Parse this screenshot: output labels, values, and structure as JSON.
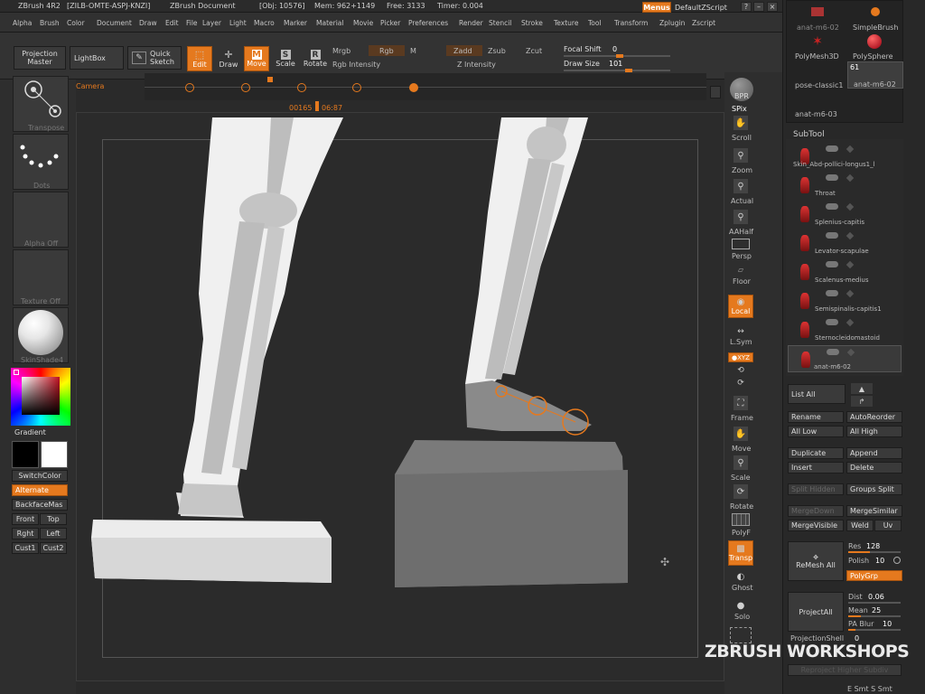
{
  "titlebar": {
    "app": "ZBrush 4R2",
    "key": "[ZILB-OMTE-ASPJ-KNZI]",
    "doc": "ZBrush Document",
    "obj": "[Obj: 10576]",
    "mem": "Mem: 962+1149",
    "free": "Free: 3133",
    "timer": "Timer: 0.004",
    "menus_btn": "Menus",
    "script_label": "DefaultZScript"
  },
  "menubar": {
    "items": [
      "Alpha",
      "Brush",
      "Color",
      "Document",
      "Draw",
      "Edit",
      "File",
      "Layer",
      "Light",
      "Macro",
      "Marker",
      "Material",
      "Movie",
      "Picker",
      "Preferences",
      "Render",
      "Stencil",
      "Stroke",
      "Texture",
      "Tool",
      "Transform",
      "Zplugin",
      "Zscript"
    ]
  },
  "toolbar": {
    "projection_master": "Projection Master",
    "lightbox": "LightBox",
    "quick_sketch": "Quick Sketch",
    "edit": "Edit",
    "draw": "Draw",
    "move": "Move",
    "scale": "Scale",
    "rotate": "Rotate",
    "mrgb": "Mrgb",
    "rgb": "Rgb",
    "m": "M",
    "zadd": "Zadd",
    "zsub": "Zsub",
    "zcut": "Zcut",
    "rgb_intensity": "Rgb Intensity",
    "z_intensity": "Z Intensity",
    "focal_shift_label": "Focal Shift",
    "focal_shift_value": "0",
    "draw_size_label": "Draw Size",
    "draw_size_value": "101"
  },
  "timeline": {
    "camera": "Camera",
    "frame": "00165",
    "time": "06:87"
  },
  "leftshelf": {
    "transpose": "Transpose",
    "dots": "Dots",
    "alpha_off": "Alpha Off",
    "texture_off": "Texture Off",
    "material": "SkinShade4",
    "gradient": "Gradient",
    "switchcolor": "SwitchColor",
    "alternate": "Alternate",
    "backface": "BackfaceMas",
    "front": "Front",
    "top": "Top",
    "right": "Rght",
    "left": "Left",
    "cust1": "Cust1",
    "cust2": "Cust2"
  },
  "rightshelf": {
    "bpr": "BPR",
    "spix": "SPix",
    "scroll": "Scroll",
    "zoom": "Zoom",
    "actual": "Actual",
    "aahalf": "AAHalf",
    "persp": "Persp",
    "floor": "Floor",
    "local": "Local",
    "lsym": "L.Sym",
    "xyz": "●XYZ",
    "frame": "Frame",
    "move": "Move",
    "scale": "Scale",
    "rotate": "Rotate",
    "polyf": "PolyF",
    "transp": "Transp",
    "ghost": "Ghost",
    "solo": "Solo"
  },
  "tray": {
    "tools": [
      {
        "label": "anat-m6-02"
      },
      {
        "label": "SimpleBrush"
      },
      {
        "label": "PolyMesh3D"
      },
      {
        "label": "PolySphere"
      },
      {
        "label": "pose-classic1"
      },
      {
        "label": "anat-m6-02",
        "count": "61"
      },
      {
        "label": "anat-m6-03"
      }
    ],
    "subtool_header": "SubTool",
    "subtools": [
      "Skin_Abd-pollici-longus1_l",
      "Throat",
      "Splenius-capitis",
      "Levator-scapulae",
      "Scalenus-medius",
      "Semispinalis-capitis1",
      "Sternocleidomastoid",
      "anat-m6-02"
    ],
    "list_all": "List All",
    "rename": "Rename",
    "autoreorder": "AutoReorder",
    "all_low": "All Low",
    "all_high": "All High",
    "duplicate": "Duplicate",
    "append": "Append",
    "insert": "Insert",
    "delete": "Delete",
    "split_hidden": "Split Hidden",
    "groups_split": "Groups Split",
    "merge_down": "MergeDown",
    "merge_similar": "MergeSimilar",
    "merge_visible": "MergeVisible",
    "weld": "Weld",
    "uv": "Uv",
    "remesh_all": "ReMesh All",
    "res_label": "Res",
    "res_value": "128",
    "polish_label": "Polish",
    "polish_value": "10",
    "polygrp": "PolyGrp",
    "project_all": "ProjectAll",
    "dist_label": "Dist",
    "dist_value": "0.06",
    "mean_label": "Mean",
    "mean_value": "25",
    "pa_blur_label": "PA Blur",
    "pa_blur_value": "10",
    "projection_shell": "ProjectionShell",
    "projection_shell_value": "0",
    "reproject_higher": "Reproject Higher Subdiv",
    "smt_row": "E Smt S Smt"
  },
  "watermark": "ZBRUSH WORKSHOPS",
  "colors": {
    "accent": "#e5791e",
    "bg": "#2a2a2a",
    "panel": "#333333"
  }
}
